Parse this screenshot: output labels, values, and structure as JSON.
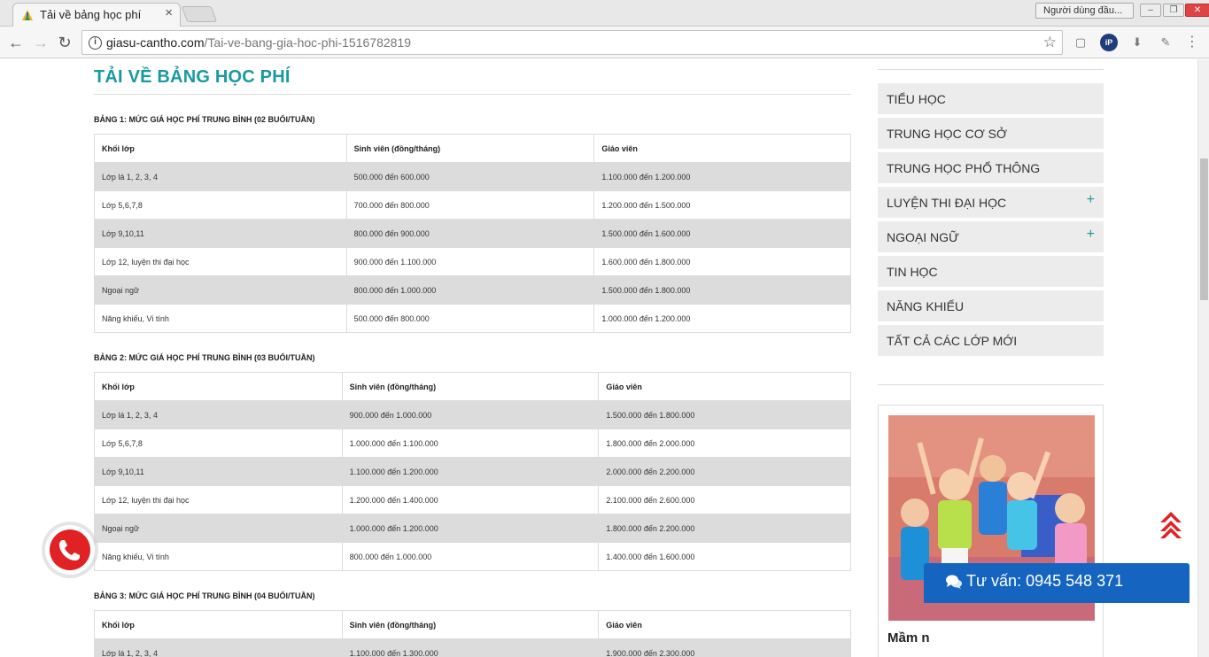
{
  "browser": {
    "tab_title": "Tải về bảng học phí",
    "tab_close": "×",
    "profile": "Người dùng đầu...",
    "url_domain": "giasu-cantho.com",
    "url_path": "/Tai-ve-bang-gia-hoc-phi-1516782819"
  },
  "page": {
    "title": "TẢI VỀ BẢNG HỌC PHÍ"
  },
  "tables": [
    {
      "caption": "BẢNG 1: MỨC GIÁ HỌC PHÍ TRUNG BÌNH (02 BUỔI/TUẦN)",
      "headers": [
        "Khối lớp",
        "Sinh viên (đồng/tháng)",
        "Giáo viên"
      ],
      "rows": [
        [
          "Lớp lá 1, 2, 3, 4",
          "500.000 đến 600.000",
          "1.100.000 đến 1.200.000"
        ],
        [
          "Lớp 5,6,7,8",
          "700.000 đến 800.000",
          "1.200.000 đến 1.500.000"
        ],
        [
          "Lớp 9,10,11",
          "800.000 đến 900.000",
          "1.500.000 đến 1.600.000"
        ],
        [
          "Lớp 12, luyện thi đại học",
          "900.000 đến 1.100.000",
          "1.600.000 đến 1.800.000"
        ],
        [
          "Ngoại ngữ",
          "800.000 đến 1.000.000",
          "1.500.000 đến 1.800.000"
        ],
        [
          "Năng khiếu, Vi tính",
          "500.000 đến 800.000",
          "1.000.000 đến 1.200.000"
        ]
      ]
    },
    {
      "caption": "BẢNG 2: MỨC GIÁ HỌC PHÍ TRUNG BÌNH (03 BUỔI/TUẦN)",
      "headers": [
        "Khối lớp",
        "Sinh viên (đồng/tháng)",
        "Giáo viên"
      ],
      "rows": [
        [
          "Lớp lá 1, 2, 3, 4",
          "900.000 đến 1.000.000",
          "1.500.000 đến 1.800.000"
        ],
        [
          "Lớp 5,6,7,8",
          "1.000.000 đến 1.100.000",
          "1.800.000 đến 2.000.000"
        ],
        [
          "Lớp 9,10,11",
          "1.100.000 đến 1.200.000",
          "2.000.000 đến 2.200.000"
        ],
        [
          "Lớp 12, luyện thi đại học",
          "1.200.000 đến 1.400.000",
          "2.100.000 đến 2.600.000"
        ],
        [
          "Ngoại ngữ",
          "1.000.000 đến 1.200.000",
          "1.800.000 đến 2.200.000"
        ],
        [
          "Năng khiếu, Vi tính",
          "800.000 đến 1.000.000",
          "1.400.000 đến 1.600.000"
        ]
      ]
    },
    {
      "caption": "BẢNG 3: MỨC GIÁ HỌC PHÍ TRUNG BÌNH (04 BUỔI/TUẦN)",
      "headers": [
        "Khối lớp",
        "Sinh viên (đồng/tháng)",
        "Giáo viên"
      ],
      "rows": [
        [
          "Lớp lá 1, 2, 3, 4",
          "1.100.000 đến 1.300.000",
          "1.900.000 đến 2.300.000"
        ]
      ]
    }
  ],
  "sidebar": {
    "categories": [
      {
        "label": "TIỂU HỌC",
        "expandable": false
      },
      {
        "label": "TRUNG HỌC CƠ SỞ",
        "expandable": false
      },
      {
        "label": "TRUNG HỌC PHỔ THÔNG",
        "expandable": false
      },
      {
        "label": "LUYỆN THI ĐẠI HỌC",
        "expandable": true
      },
      {
        "label": "NGOẠI NGỮ",
        "expandable": true
      },
      {
        "label": "TIN HỌC",
        "expandable": false
      },
      {
        "label": "NĂNG KHIẾU",
        "expandable": false
      },
      {
        "label": "TẤT CẢ CÁC LỚP MỚI",
        "expandable": false
      }
    ],
    "plus_symbol": "+",
    "promo_caption": "Mầm n"
  },
  "widgets": {
    "consult_label": "Tư vấn: 0945 548 371"
  },
  "colors": {
    "accent": "#1a9aa0",
    "stripe": "#dcdcdc",
    "call": "#e02224",
    "consult": "#1565c0",
    "backtop": "#e02224"
  }
}
